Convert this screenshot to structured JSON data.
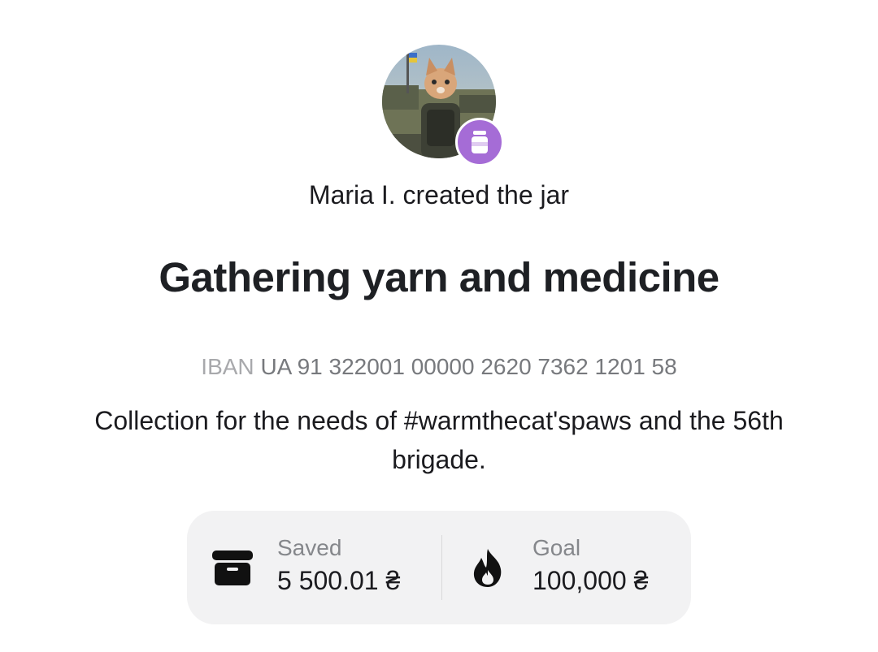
{
  "creator": {
    "name": "Maria I.",
    "text": "Maria I. created the jar"
  },
  "jar": {
    "title": "Gathering yarn and medicine",
    "iban_prefix": "IBAN",
    "iban": "UA 91 322001 00000 2620 7362 1201 58",
    "description": "Collection for the needs of #warmthecat'spaws and the 56th brigade."
  },
  "stats": {
    "saved": {
      "label": "Saved",
      "value": "5 500.01 ₴",
      "icon": "archive-box-icon"
    },
    "goal": {
      "label": "Goal",
      "value": "100,000 ₴",
      "icon": "flame-icon"
    }
  },
  "colors": {
    "badge": "#a56cd6",
    "stats_background": "#f2f2f3",
    "title": "#1e2024",
    "muted": "#85878b"
  }
}
